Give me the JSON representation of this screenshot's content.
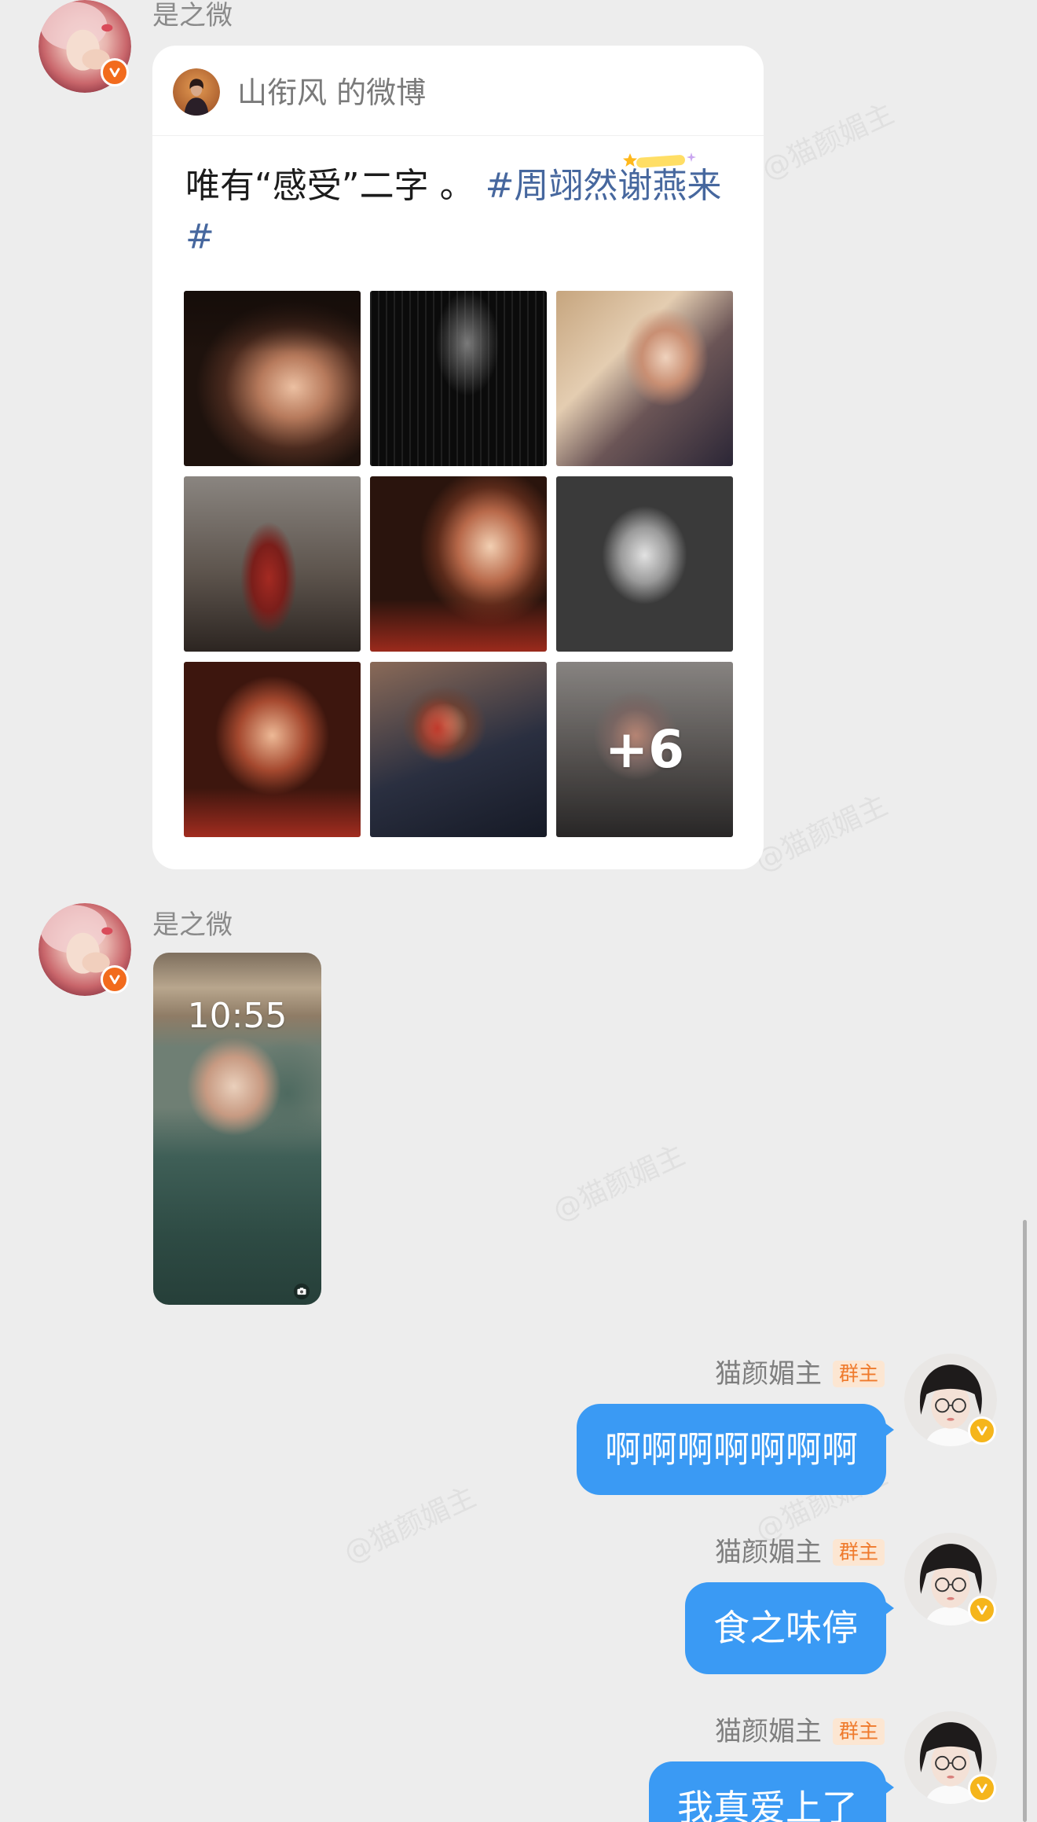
{
  "watermark": "@猫颜媚主",
  "colors": {
    "background": "#ededed",
    "bubble_outgoing": "#3a9af4",
    "hashtag": "#46679e",
    "verified_badge_incoming": "#f26b1d",
    "verified_badge_outgoing": "#f5b51b",
    "owner_badge_text": "#ef7a2c",
    "owner_badge_background": "#fce6d2"
  },
  "icons": {
    "verified": "verified-badge-icon",
    "hashtag_decoration": "hashtag-sparkle-icon",
    "camera": "camera-icon"
  },
  "messages": [
    {
      "sender": "是之微",
      "weibo_card": {
        "source": "山衔风 的微博",
        "text": "唯有“感受”二字 。 ",
        "hashtag": "#周翊然谢燕来#",
        "more_images": "+6"
      }
    },
    {
      "sender": "是之微",
      "image": {
        "lockscreen_time": "10:55"
      }
    },
    {
      "sender": "猫颜媚主",
      "role": "群主",
      "text": "啊啊啊啊啊啊啊"
    },
    {
      "sender": "猫颜媚主",
      "role": "群主",
      "text": "食之味停"
    },
    {
      "sender": "猫颜媚主",
      "role": "群主",
      "text": "我真爱上了"
    }
  ]
}
